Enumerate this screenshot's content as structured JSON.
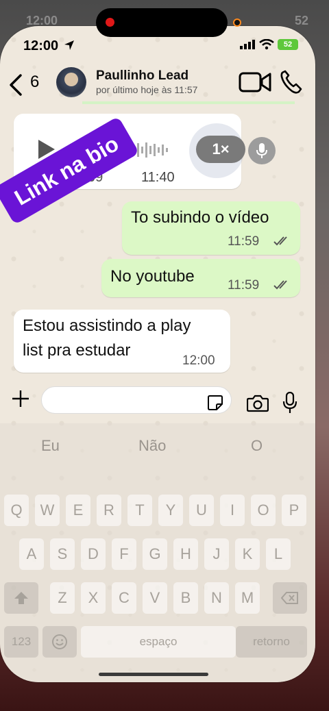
{
  "status_bar": {
    "time": "12:00",
    "battery": "52"
  },
  "header": {
    "back_count": "6",
    "contact_name": "Paullinho Lead",
    "contact_status": "por último hoje às 11:57"
  },
  "audio_message": {
    "duration": "09",
    "time": "11:40",
    "speed": "1×"
  },
  "sticker": {
    "text": "Link na bio"
  },
  "messages": [
    {
      "direction": "out",
      "text": "To subindo o vídeo",
      "time": "11:59",
      "read": true
    },
    {
      "direction": "out",
      "text": "No youtube",
      "time": "11:59",
      "read": true
    },
    {
      "direction": "in",
      "text_line1": "Estou assistindo a play",
      "text_line2": "list pra estudar",
      "time": "12:00"
    }
  ],
  "composer": {
    "value": ""
  },
  "keyboard": {
    "suggestions": [
      "Eu",
      "Não",
      "O"
    ],
    "row1": [
      "Q",
      "W",
      "E",
      "R",
      "T",
      "Y",
      "U",
      "I",
      "O",
      "P"
    ],
    "row2": [
      "A",
      "S",
      "D",
      "F",
      "G",
      "H",
      "J",
      "K",
      "L"
    ],
    "row3": [
      "Z",
      "X",
      "C",
      "V",
      "B",
      "N",
      "M"
    ],
    "numbers_label": "123",
    "space_label": "espaço",
    "return_label": "retorno"
  }
}
